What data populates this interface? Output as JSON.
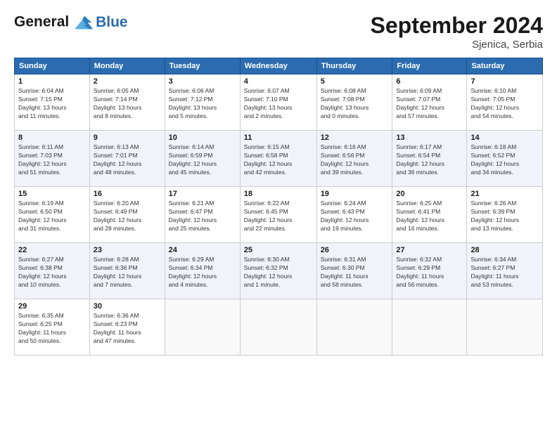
{
  "logo": {
    "line1": "General",
    "line2": "Blue"
  },
  "title": "September 2024",
  "location": "Sjenica, Serbia",
  "days_header": [
    "Sunday",
    "Monday",
    "Tuesday",
    "Wednesday",
    "Thursday",
    "Friday",
    "Saturday"
  ],
  "weeks": [
    [
      {
        "day": "1",
        "detail": "Sunrise: 6:04 AM\nSunset: 7:15 PM\nDaylight: 13 hours\nand 11 minutes."
      },
      {
        "day": "2",
        "detail": "Sunrise: 6:05 AM\nSunset: 7:14 PM\nDaylight: 13 hours\nand 8 minutes."
      },
      {
        "day": "3",
        "detail": "Sunrise: 6:06 AM\nSunset: 7:12 PM\nDaylight: 13 hours\nand 5 minutes."
      },
      {
        "day": "4",
        "detail": "Sunrise: 6:07 AM\nSunset: 7:10 PM\nDaylight: 13 hours\nand 2 minutes."
      },
      {
        "day": "5",
        "detail": "Sunrise: 6:08 AM\nSunset: 7:08 PM\nDaylight: 13 hours\nand 0 minutes."
      },
      {
        "day": "6",
        "detail": "Sunrise: 6:09 AM\nSunset: 7:07 PM\nDaylight: 12 hours\nand 57 minutes."
      },
      {
        "day": "7",
        "detail": "Sunrise: 6:10 AM\nSunset: 7:05 PM\nDaylight: 12 hours\nand 54 minutes."
      }
    ],
    [
      {
        "day": "8",
        "detail": "Sunrise: 6:11 AM\nSunset: 7:03 PM\nDaylight: 12 hours\nand 51 minutes."
      },
      {
        "day": "9",
        "detail": "Sunrise: 6:13 AM\nSunset: 7:01 PM\nDaylight: 12 hours\nand 48 minutes."
      },
      {
        "day": "10",
        "detail": "Sunrise: 6:14 AM\nSunset: 6:59 PM\nDaylight: 12 hours\nand 45 minutes."
      },
      {
        "day": "11",
        "detail": "Sunrise: 6:15 AM\nSunset: 6:58 PM\nDaylight: 12 hours\nand 42 minutes."
      },
      {
        "day": "12",
        "detail": "Sunrise: 6:16 AM\nSunset: 6:56 PM\nDaylight: 12 hours\nand 39 minutes."
      },
      {
        "day": "13",
        "detail": "Sunrise: 6:17 AM\nSunset: 6:54 PM\nDaylight: 12 hours\nand 36 minutes."
      },
      {
        "day": "14",
        "detail": "Sunrise: 6:18 AM\nSunset: 6:52 PM\nDaylight: 12 hours\nand 34 minutes."
      }
    ],
    [
      {
        "day": "15",
        "detail": "Sunrise: 6:19 AM\nSunset: 6:50 PM\nDaylight: 12 hours\nand 31 minutes."
      },
      {
        "day": "16",
        "detail": "Sunrise: 6:20 AM\nSunset: 6:49 PM\nDaylight: 12 hours\nand 28 minutes."
      },
      {
        "day": "17",
        "detail": "Sunrise: 6:21 AM\nSunset: 6:47 PM\nDaylight: 12 hours\nand 25 minutes."
      },
      {
        "day": "18",
        "detail": "Sunrise: 6:22 AM\nSunset: 6:45 PM\nDaylight: 12 hours\nand 22 minutes."
      },
      {
        "day": "19",
        "detail": "Sunrise: 6:24 AM\nSunset: 6:43 PM\nDaylight: 12 hours\nand 19 minutes."
      },
      {
        "day": "20",
        "detail": "Sunrise: 6:25 AM\nSunset: 6:41 PM\nDaylight: 12 hours\nand 16 minutes."
      },
      {
        "day": "21",
        "detail": "Sunrise: 6:26 AM\nSunset: 6:39 PM\nDaylight: 12 hours\nand 13 minutes."
      }
    ],
    [
      {
        "day": "22",
        "detail": "Sunrise: 6:27 AM\nSunset: 6:38 PM\nDaylight: 12 hours\nand 10 minutes."
      },
      {
        "day": "23",
        "detail": "Sunrise: 6:28 AM\nSunset: 6:36 PM\nDaylight: 12 hours\nand 7 minutes."
      },
      {
        "day": "24",
        "detail": "Sunrise: 6:29 AM\nSunset: 6:34 PM\nDaylight: 12 hours\nand 4 minutes."
      },
      {
        "day": "25",
        "detail": "Sunrise: 6:30 AM\nSunset: 6:32 PM\nDaylight: 12 hours\nand 1 minute."
      },
      {
        "day": "26",
        "detail": "Sunrise: 6:31 AM\nSunset: 6:30 PM\nDaylight: 11 hours\nand 58 minutes."
      },
      {
        "day": "27",
        "detail": "Sunrise: 6:32 AM\nSunset: 6:29 PM\nDaylight: 11 hours\nand 56 minutes."
      },
      {
        "day": "28",
        "detail": "Sunrise: 6:34 AM\nSunset: 6:27 PM\nDaylight: 11 hours\nand 53 minutes."
      }
    ],
    [
      {
        "day": "29",
        "detail": "Sunrise: 6:35 AM\nSunset: 6:25 PM\nDaylight: 11 hours\nand 50 minutes."
      },
      {
        "day": "30",
        "detail": "Sunrise: 6:36 AM\nSunset: 6:23 PM\nDaylight: 11 hours\nand 47 minutes."
      },
      null,
      null,
      null,
      null,
      null
    ]
  ]
}
